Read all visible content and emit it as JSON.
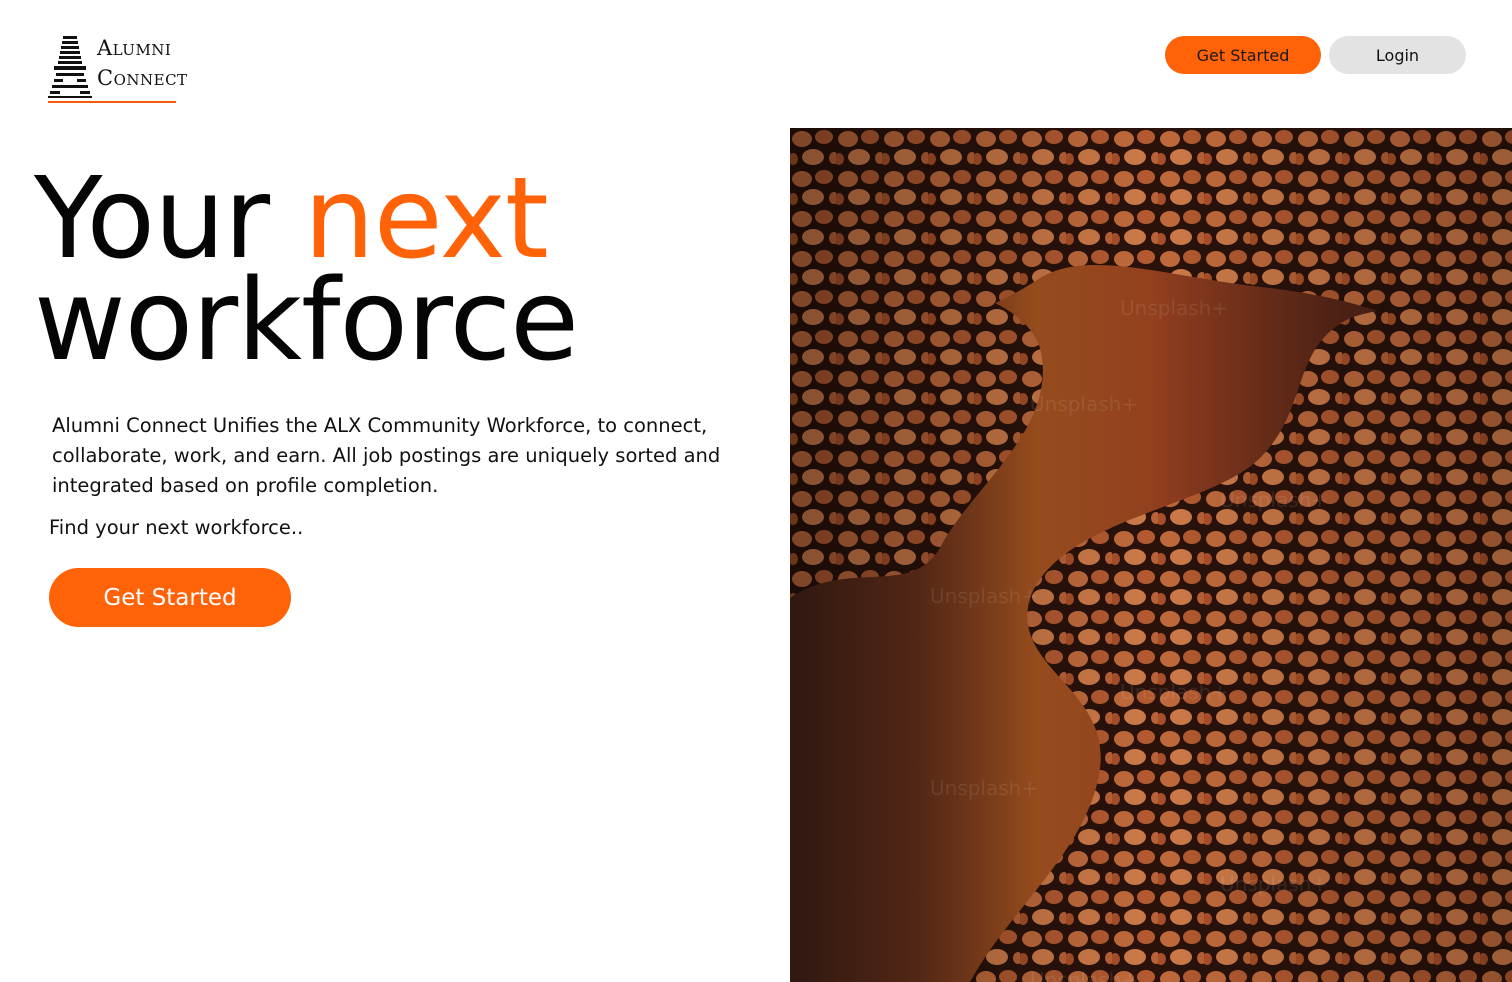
{
  "header": {
    "logo": {
      "line1": "Alumni",
      "line2": "Connect",
      "icon": "stacked-lines-a-logo-icon"
    },
    "get_started_label": "Get Started",
    "login_label": "Login"
  },
  "hero": {
    "title_part1": "Your",
    "title_accent": "next",
    "title_part2": "workforce",
    "description": "Alumni Connect Unifies the ALX Community Workforce, to connect, collaborate, work, and earn. All job postings are uniquely sorted and integrated based on profile completion.",
    "tagline": "Find your next workforce..",
    "cta_label": "Get Started"
  },
  "image": {
    "watermark": "Unsplash+"
  },
  "colors": {
    "accent": "#ff6207",
    "login_bg": "#e3e3e3",
    "text": "#050505"
  }
}
